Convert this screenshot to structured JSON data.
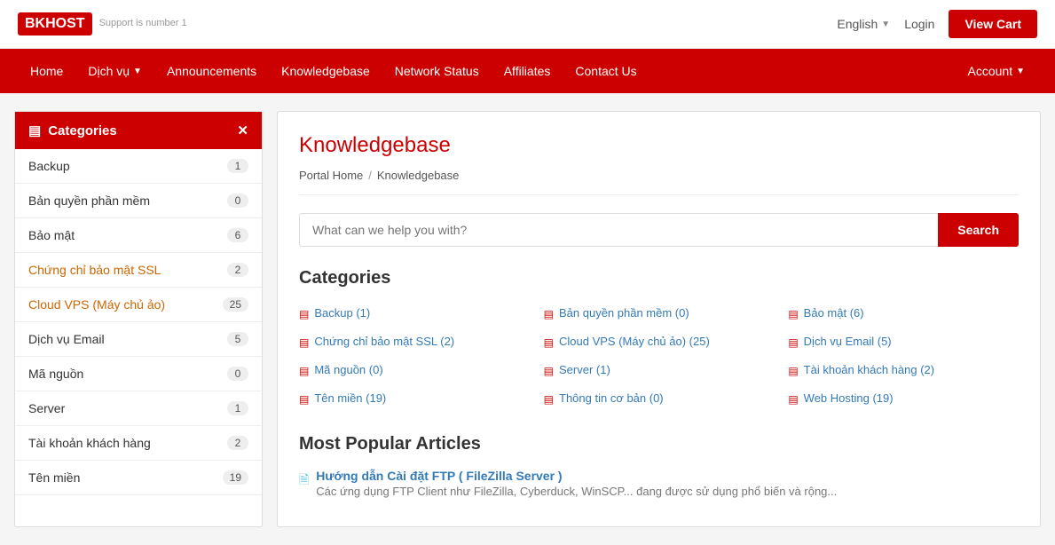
{
  "topbar": {
    "logo_bk": "BK",
    "logo_host": "HOST",
    "tagline": "Support is number 1",
    "lang": "English",
    "login_label": "Login",
    "view_cart_label": "View Cart"
  },
  "nav": {
    "items": [
      {
        "label": "Home",
        "dropdown": false
      },
      {
        "label": "Dịch vụ",
        "dropdown": true
      },
      {
        "label": "Announcements",
        "dropdown": false
      },
      {
        "label": "Knowledgebase",
        "dropdown": false
      },
      {
        "label": "Network Status",
        "dropdown": false
      },
      {
        "label": "Affiliates",
        "dropdown": false
      },
      {
        "label": "Contact Us",
        "dropdown": false
      }
    ],
    "account_label": "Account"
  },
  "sidebar": {
    "header": "Categories",
    "items": [
      {
        "label": "Backup",
        "count": "1",
        "highlight": false
      },
      {
        "label": "Bản quyền phần mềm",
        "count": "0",
        "highlight": false
      },
      {
        "label": "Bảo mật",
        "count": "6",
        "highlight": false
      },
      {
        "label": "Chứng chỉ bảo mật SSL",
        "count": "2",
        "highlight": true
      },
      {
        "label": "Cloud VPS (Máy chủ ảo)",
        "count": "25",
        "highlight": true
      },
      {
        "label": "Dịch vụ Email",
        "count": "5",
        "highlight": false
      },
      {
        "label": "Mã nguồn",
        "count": "0",
        "highlight": false
      },
      {
        "label": "Server",
        "count": "1",
        "highlight": false
      },
      {
        "label": "Tài khoản khách hàng",
        "count": "2",
        "highlight": false
      },
      {
        "label": "Tên miền",
        "count": "19",
        "highlight": false
      }
    ]
  },
  "content": {
    "page_title": "Knowledgebase",
    "breadcrumb": {
      "home": "Portal Home",
      "sep": "/",
      "current": "Knowledgebase"
    },
    "search": {
      "placeholder": "What can we help you with?",
      "button_label": "Search"
    },
    "categories_title": "Categories",
    "categories": [
      {
        "label": "Backup (1)",
        "col": 1
      },
      {
        "label": "Bản quyền phần mềm (0)",
        "col": 2
      },
      {
        "label": "Bảo mật (6)",
        "col": 3
      },
      {
        "label": "Chứng chỉ bảo mật SSL (2)",
        "col": 1
      },
      {
        "label": "Cloud VPS (Máy chủ ảo) (25)",
        "col": 2
      },
      {
        "label": "Dịch vụ Email (5)",
        "col": 3
      },
      {
        "label": "Mã nguồn (0)",
        "col": 1
      },
      {
        "label": "Server (1)",
        "col": 2
      },
      {
        "label": "Tài khoản khách hàng (2)",
        "col": 3
      },
      {
        "label": "Tên miền (19)",
        "col": 1
      },
      {
        "label": "Thông tin cơ bản (0)",
        "col": 2
      },
      {
        "label": "Web Hosting (19)",
        "col": 3
      }
    ],
    "popular_title": "Most Popular Articles",
    "popular_articles": [
      {
        "title": "Hướng dẫn Cài đặt FTP ( FileZilla Server )",
        "desc": "Các ứng dụng FTP Client như FileZilla, Cyberduck, WinSCP... đang được sử dụng phổ biến và rộng..."
      }
    ]
  }
}
